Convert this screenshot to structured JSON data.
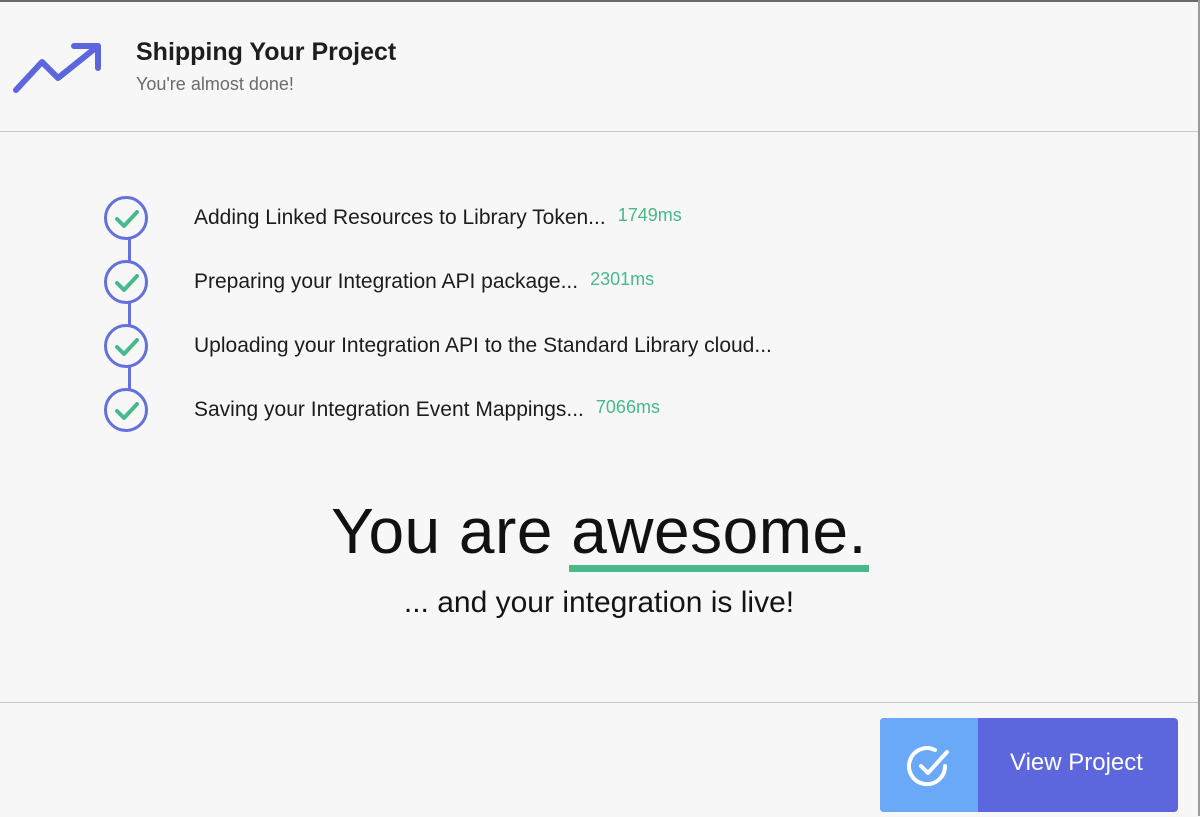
{
  "header": {
    "title": "Shipping Your Project",
    "subtitle": "You're almost done!",
    "icon": "trending-up-icon"
  },
  "steps": [
    {
      "label": "Adding Linked Resources to Library Token...",
      "time": "1749ms",
      "status": "done"
    },
    {
      "label": "Preparing your Integration API package...",
      "time": "2301ms",
      "status": "done"
    },
    {
      "label": "Uploading your Integration API to the Standard Library cloud...",
      "time": "",
      "status": "done"
    },
    {
      "label": "Saving your Integration Event Mappings...",
      "time": "7066ms",
      "status": "done"
    }
  ],
  "headline": {
    "prefix": "You are",
    "highlight": "awesome."
  },
  "subline": "... and your integration is live!",
  "footer": {
    "button_label": "View Project",
    "button_icon": "check-circle-icon"
  },
  "colors": {
    "accent": "#6470db",
    "success": "#47b98a",
    "button": "#5c67de",
    "button_icon_bg": "#6aa8f8"
  }
}
